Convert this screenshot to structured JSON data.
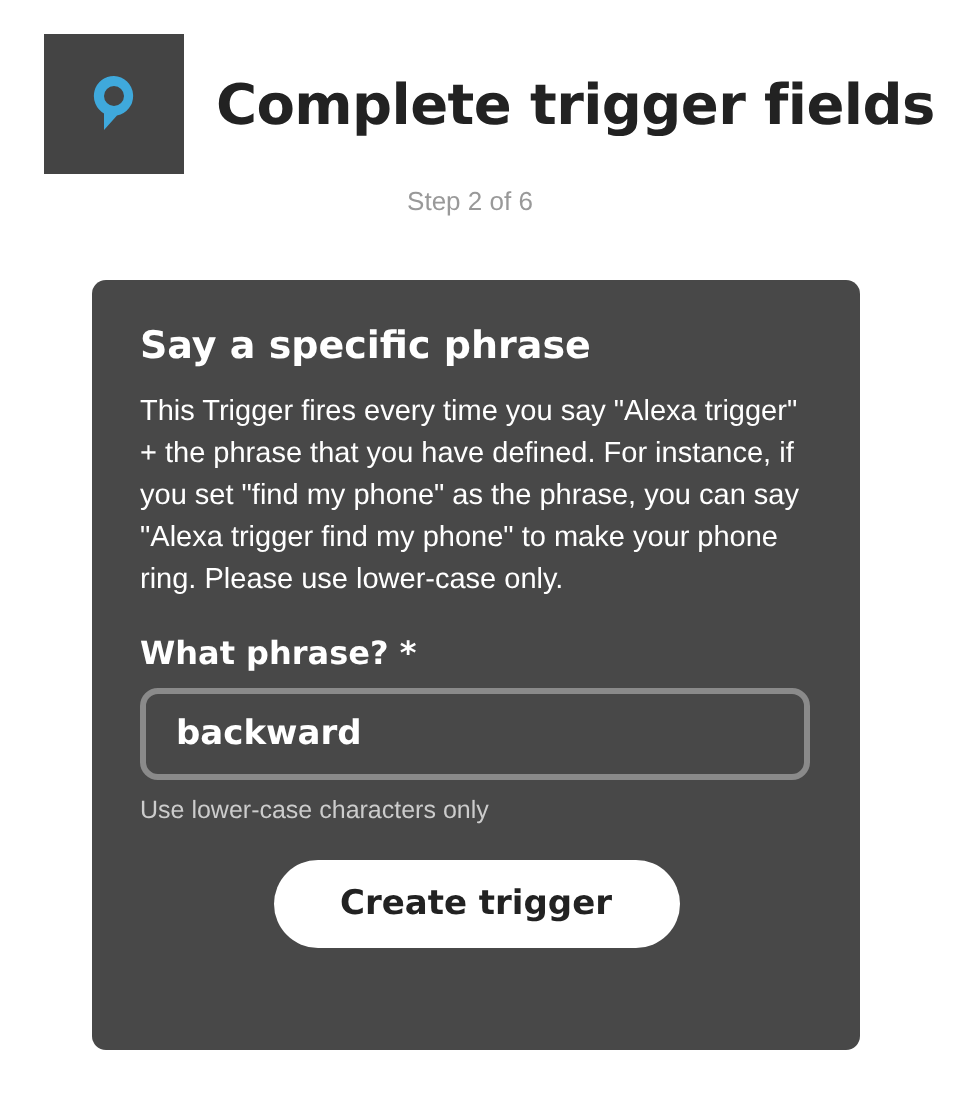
{
  "header": {
    "title": "Complete trigger fields",
    "step": "Step 2 of 6"
  },
  "card": {
    "title": "Say a specific phrase",
    "description": "This Trigger fires every time you say \"Alexa trigger\" + the phrase that you have defined. For instance, if you set \"find my phone\" as the phrase, you can say \"Alexa trigger find my phone\" to make your phone ring. Please use lower-case only.",
    "field": {
      "label": "What phrase? *",
      "value": "backward",
      "help": "Use lower-case characters only"
    },
    "button": "Create trigger"
  }
}
